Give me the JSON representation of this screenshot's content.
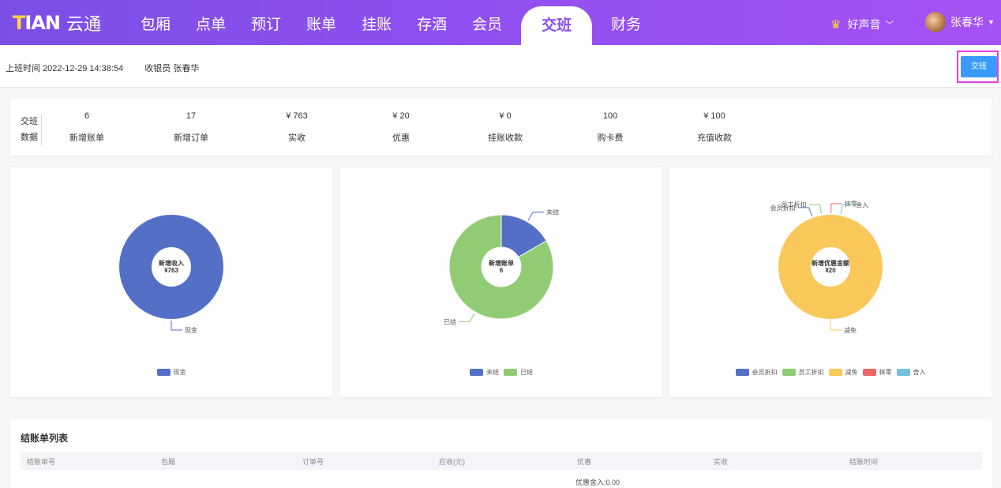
{
  "app": {
    "logo_brand": "TIAN",
    "logo_text": "云通"
  },
  "nav": {
    "items": [
      {
        "label": "包厢"
      },
      {
        "label": "点单"
      },
      {
        "label": "预订"
      },
      {
        "label": "账单"
      },
      {
        "label": "挂账"
      },
      {
        "label": "存酒"
      },
      {
        "label": "会员"
      },
      {
        "label": "交班",
        "active": true
      },
      {
        "label": "财务"
      }
    ],
    "store_name": "好声音",
    "store_icon": "crown-icon",
    "user_name": "张春华"
  },
  "shift": {
    "start_label": "上班时间",
    "start_time": "2022-12-29 14:38:54",
    "cashier_label": "收银员",
    "cashier_name": "张春华",
    "handover_button": "交班"
  },
  "stats": {
    "label_line1": "交班",
    "label_line2": "数据",
    "items": [
      {
        "value": "6",
        "label": "新增账单"
      },
      {
        "value": "17",
        "label": "新增订单"
      },
      {
        "value": "¥ 763",
        "label": "实收"
      },
      {
        "value": "¥ 20",
        "label": "优惠"
      },
      {
        "value": "¥ 0",
        "label": "挂账收款"
      },
      {
        "value": "100",
        "label": "购卡费"
      },
      {
        "value": "¥ 100",
        "label": "充值收款"
      }
    ]
  },
  "chart_data": [
    {
      "type": "pie",
      "style": "donut",
      "center_title": "新增收入",
      "center_value": "¥763",
      "slices": [
        {
          "label": "现金",
          "value": 763,
          "color": "#5470c6"
        }
      ],
      "legend": [
        "现金"
      ],
      "legend_placement": "bottom"
    },
    {
      "type": "pie",
      "style": "donut",
      "center_title": "新增账单",
      "center_value": "6",
      "slices": [
        {
          "label": "未结",
          "value": 1,
          "color": "#5470c6"
        },
        {
          "label": "已结",
          "value": 5,
          "color": "#91cc75"
        }
      ],
      "legend": [
        "未结",
        "已结"
      ],
      "legend_placement": "bottom"
    },
    {
      "type": "pie",
      "style": "donut",
      "center_title": "新增优惠金额",
      "center_value": "¥20",
      "slices": [
        {
          "label": "会员折扣",
          "value": 0,
          "color": "#5470c6"
        },
        {
          "label": "员工折扣",
          "value": 0,
          "color": "#91cc75"
        },
        {
          "label": "减免",
          "value": 20,
          "color": "#fac858"
        },
        {
          "label": "抹零",
          "value": 0,
          "color": "#ee6666"
        },
        {
          "label": "舍入",
          "value": 0,
          "color": "#73c0de"
        }
      ],
      "legend": [
        "会员折扣",
        "员工折扣",
        "减免",
        "抹零",
        "舍入"
      ],
      "legend_placement": "bottom"
    }
  ],
  "table": {
    "title": "结账单列表",
    "columns": [
      "结账单号",
      "包厢",
      "订单号",
      "应收(元)",
      "优惠",
      "实收",
      "结账时间"
    ],
    "rows": [
      {
        "discount": "优惠舍入:0.00"
      }
    ]
  }
}
